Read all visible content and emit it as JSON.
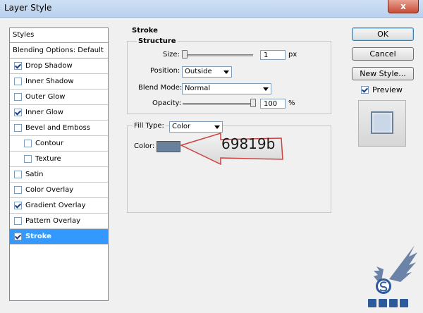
{
  "window": {
    "title": "Layer Style",
    "close_label": "x"
  },
  "styles_panel": {
    "header": "Styles",
    "blending_options": "Blending Options: Default",
    "items": [
      {
        "label": "Drop Shadow",
        "checked": true,
        "sub": false,
        "selected": false
      },
      {
        "label": "Inner Shadow",
        "checked": false,
        "sub": false,
        "selected": false
      },
      {
        "label": "Outer Glow",
        "checked": false,
        "sub": false,
        "selected": false
      },
      {
        "label": "Inner Glow",
        "checked": true,
        "sub": false,
        "selected": false
      },
      {
        "label": "Bevel and Emboss",
        "checked": false,
        "sub": false,
        "selected": false
      },
      {
        "label": "Contour",
        "checked": false,
        "sub": true,
        "selected": false
      },
      {
        "label": "Texture",
        "checked": false,
        "sub": true,
        "selected": false
      },
      {
        "label": "Satin",
        "checked": false,
        "sub": false,
        "selected": false
      },
      {
        "label": "Color Overlay",
        "checked": false,
        "sub": false,
        "selected": false
      },
      {
        "label": "Gradient Overlay",
        "checked": true,
        "sub": false,
        "selected": false
      },
      {
        "label": "Pattern Overlay",
        "checked": false,
        "sub": false,
        "selected": false
      },
      {
        "label": "Stroke",
        "checked": true,
        "sub": false,
        "selected": true
      }
    ]
  },
  "stroke": {
    "section_title": "Stroke",
    "structure_title": "Structure",
    "size_label": "Size:",
    "size_value": "1",
    "size_unit": "px",
    "position_label": "Position:",
    "position_value": "Outside",
    "blend_mode_label": "Blend Mode:",
    "blend_mode_value": "Normal",
    "opacity_label": "Opacity:",
    "opacity_value": "100",
    "opacity_unit": "%",
    "fill_type_label": "Fill Type:",
    "fill_type_value": "Color",
    "color_label": "Color:",
    "color_hex": "#69819b"
  },
  "callout": {
    "text": "69819b"
  },
  "buttons": {
    "ok": "OK",
    "cancel": "Cancel",
    "new_style": "New Style...",
    "preview_label": "Preview",
    "preview_checked": true
  }
}
